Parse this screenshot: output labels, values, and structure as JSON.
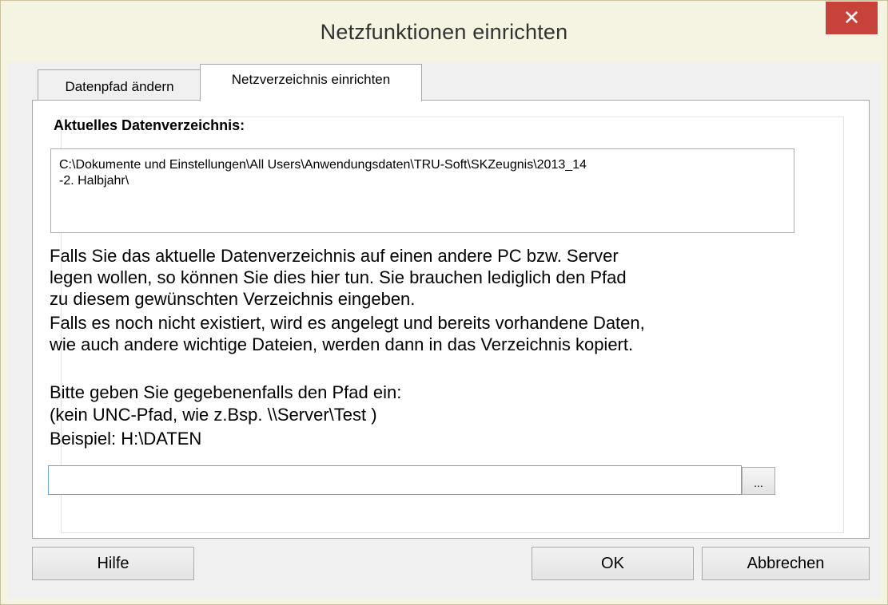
{
  "window": {
    "title": "Netzfunktionen einrichten",
    "close_label": "✕"
  },
  "tabs": [
    {
      "label": "Datenpfad ändern",
      "active": false
    },
    {
      "label": "Netzverzeichnis einrichten",
      "active": true
    }
  ],
  "panel": {
    "current_dir_label": "Aktuelles Datenverzeichnis:",
    "current_dir_value": "C:\\Dokumente und Einstellungen\\All Users\\Anwendungsdaten\\TRU-Soft\\SKZeugnis\\2013_14\n-2. Halbjahr\\",
    "info_1": "Falls Sie das aktuelle Datenverzeichnis auf einen andere PC bzw. Server\nlegen wollen, so können Sie dies hier tun. Sie brauchen lediglich den Pfad\nzu diesem gewünschten Verzeichnis eingeben.",
    "info_2": "Falls es noch nicht existiert, wird es angelegt und bereits vorhandene Daten,\nwie auch andere wichtige Dateien,  werden dann in das Verzeichnis kopiert.",
    "prompt": "Bitte geben Sie gegebenenfalls den Pfad ein:",
    "unc_note": "(kein UNC-Pfad, wie z.Bsp. \\\\Server\\Test )",
    "example": "Beispiel:   H:\\DATEN",
    "path_input_value": "",
    "browse_label": "..."
  },
  "buttons": {
    "help": "Hilfe",
    "ok": "OK",
    "cancel": "Abbrechen"
  },
  "colors": {
    "title_bar": "#f5f3e1",
    "close_button": "#c7423a",
    "input_border_focus": "#6aa3d9"
  },
  "icons": {
    "close": "close-icon"
  }
}
